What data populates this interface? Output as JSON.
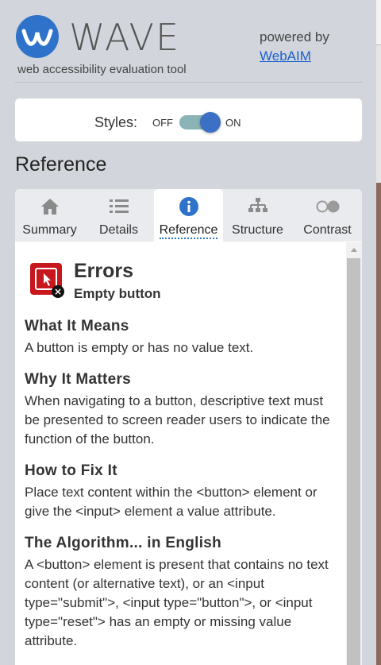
{
  "header": {
    "brand": "WAVE",
    "tagline": "web accessibility evaluation tool",
    "powered_by": "powered by",
    "webaim_link": "WebAIM"
  },
  "styles_toggle": {
    "label": "Styles:",
    "off": "OFF",
    "on": "ON",
    "state": "on"
  },
  "section_title": "Reference",
  "tabs": [
    {
      "label": "Summary",
      "icon": "home-icon",
      "active": false
    },
    {
      "label": "Details",
      "icon": "list-icon",
      "active": false
    },
    {
      "label": "Reference",
      "icon": "info-icon",
      "active": true
    },
    {
      "label": "Structure",
      "icon": "sitemap-icon",
      "active": false
    },
    {
      "label": "Contrast",
      "icon": "contrast-toggle-icon",
      "active": false
    }
  ],
  "reference": {
    "category": "Errors",
    "item": "Empty button",
    "sections": [
      {
        "heading": "What It Means",
        "body": "A button is empty or has no value text."
      },
      {
        "heading": "Why It Matters",
        "body": "When navigating to a button, descriptive text must be presented to screen reader users to indicate the function of the button."
      },
      {
        "heading": "How to Fix It",
        "body": "Place text content within the <button> element or give the <input> element a value attribute."
      },
      {
        "heading": "The Algorithm... in English",
        "body": "A <button> element is present that contains no text content (or alternative text), or an <input type=\"submit\">, <input type=\"button\">, or <input type=\"reset\"> has an empty or missing value attribute."
      }
    ]
  },
  "colors": {
    "accent": "#2e73c9",
    "error": "#c8161d",
    "background": "#d2d6dc"
  }
}
